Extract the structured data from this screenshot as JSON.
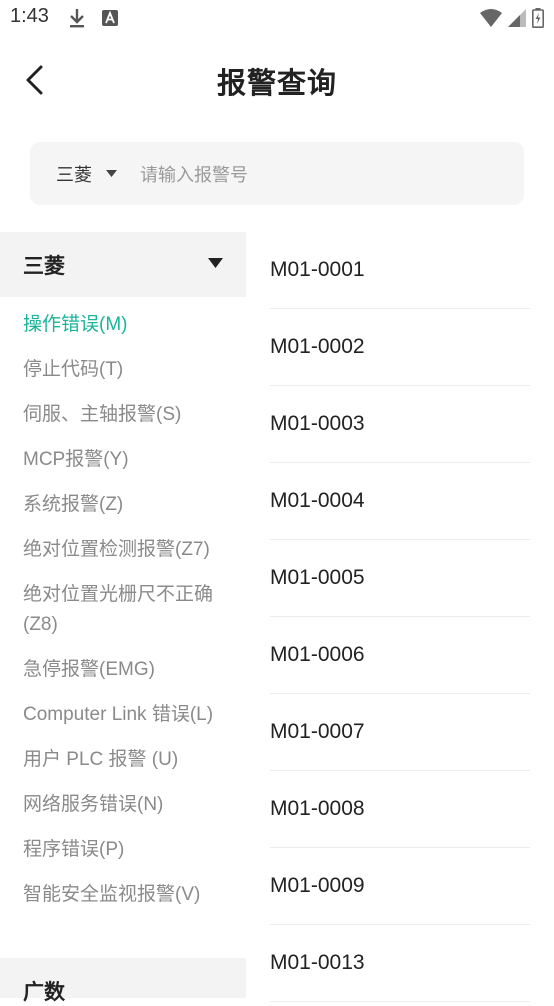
{
  "status_bar": {
    "time": "1:43",
    "icons": [
      "download-icon",
      "a-badge-icon",
      "wifi-icon",
      "signal-icon",
      "battery-charging-icon"
    ]
  },
  "header": {
    "title": "报警查询",
    "back_icon": "chevron-left-icon"
  },
  "search": {
    "brand": "三菱",
    "placeholder": "请输入报警号",
    "value": ""
  },
  "brand_panel": {
    "title": "三菱",
    "categories": [
      {
        "label": "操作错误(M)",
        "active": true
      },
      {
        "label": "停止代码(T)"
      },
      {
        "label": "伺服、主轴报警(S)"
      },
      {
        "label": "MCP报警(Y)"
      },
      {
        "label": "系统报警(Z)"
      },
      {
        "label": "绝对位置检测报警(Z7)"
      },
      {
        "label": "绝对位置光栅尺不正确(Z8)"
      },
      {
        "label": "急停报警(EMG)"
      },
      {
        "label": "Computer Link 错误(L)"
      },
      {
        "label": "用户 PLC 报警 (U)"
      },
      {
        "label": "网络服务错误(N)"
      },
      {
        "label": "程序错误(P)"
      },
      {
        "label": "智能安全监视报警(V)"
      }
    ],
    "next_brand": "广数"
  },
  "codes": [
    "M01-0001",
    "M01-0002",
    "M01-0003",
    "M01-0004",
    "M01-0005",
    "M01-0006",
    "M01-0007",
    "M01-0008",
    "M01-0009",
    "M01-0013"
  ],
  "colors": {
    "accent": "#1ab59a",
    "muted_text": "#8a8a8a",
    "panel_bg": "#f3f3f3",
    "search_bg": "#f5f5f5"
  }
}
